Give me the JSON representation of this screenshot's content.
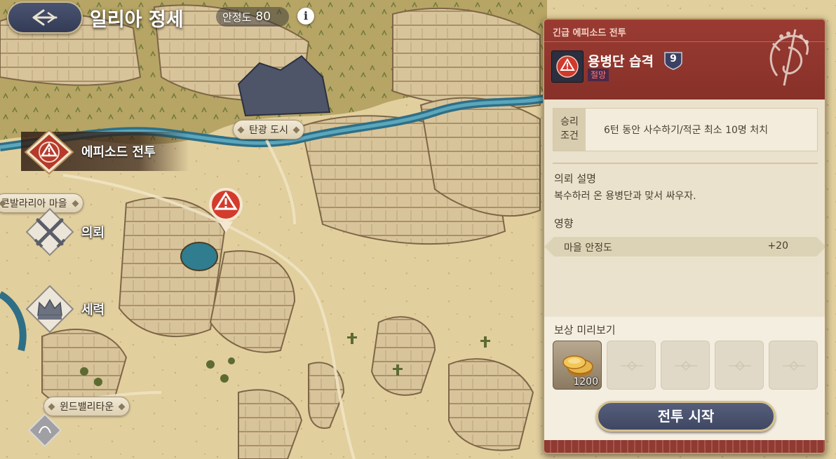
{
  "header": {
    "title": "일리아 정세",
    "stability_label": "안정도",
    "stability_value": "80",
    "info_glyph": "i",
    "back_icon": "back-arrow-icon"
  },
  "map": {
    "labels": {
      "mine_city": "탄광 도시",
      "konvalaria": "콘발라리아 마을",
      "windvalley": "윈드밸리타운"
    }
  },
  "side_menu": {
    "episode_battle": "에피소드 전투",
    "request": "의뢰",
    "faction": "세력"
  },
  "panel": {
    "tag": "긴급 에피소드 전투",
    "mission_name": "용병단 습격",
    "level": "9",
    "difficulty": "절망",
    "win_condition": {
      "label_line1": "승리",
      "label_line2": "조건",
      "text": "6턴 동안 사수하기/적군 최소 10명 처치"
    },
    "description": {
      "title": "의뢰 설명",
      "text": "복수하러 온 용병단과 맞서 싸우자."
    },
    "effects": {
      "title": "영향",
      "items": [
        {
          "name": "마을 안정도",
          "value": "+20"
        }
      ]
    },
    "rewards": {
      "title": "보상 미리보기",
      "items": [
        {
          "icon": "gold-coins-icon",
          "quantity": "1200"
        }
      ]
    },
    "start_button": "전투 시작"
  },
  "colors": {
    "panel_header": "#8f352c",
    "button": "#474f6b",
    "panel_bg": "#ebe2cd"
  }
}
